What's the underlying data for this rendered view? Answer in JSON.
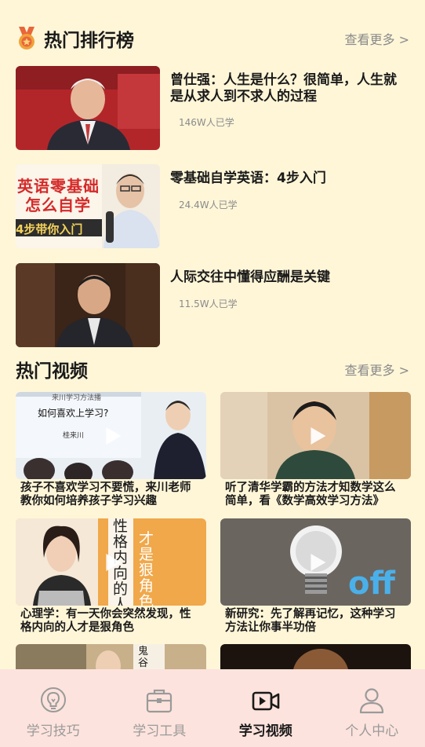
{
  "hot_ranking": {
    "title": "热门排行榜",
    "more": "查看更多 >",
    "items": [
      {
        "title": "曾仕强：人生是什么？很简单，人生就是从求人到不求人的过程",
        "count": "146W人已学"
      },
      {
        "title": "零基础自学英语：4步入门",
        "count": "24.4W人已学",
        "thumb_text_1": "英语零基础",
        "thumb_text_2": "怎么自学",
        "thumb_text_3": "4步带你入门"
      },
      {
        "title": "人际交往中懂得应酬是关键",
        "count": "11.5W人已学"
      }
    ]
  },
  "hot_videos": {
    "title": "热门视频",
    "more": "查看更多 >",
    "items": [
      {
        "title": "孩子不喜欢学习不要慌，来川老师教你如何培养孩子学习兴趣",
        "thumb_text_1": "来川学习方法播",
        "thumb_text_2": "如何喜欢上学习?",
        "thumb_text_3": "桂来川"
      },
      {
        "title": "听了清华学霸的方法才知数学这么简单，看《数学高效学习方法》"
      },
      {
        "title": "心理学：有一天你会突然发现，性格内向的人才是狠角色",
        "thumb_text_1": "性格内向的人",
        "thumb_text_2": "才是狠角色"
      },
      {
        "title": "新研究：先了解再记忆，这种学习方法让你事半功倍",
        "thumb_text_1": "off"
      },
      {
        "title": "",
        "thumb_text_1": "鬼谷"
      },
      {
        "title": ""
      }
    ]
  },
  "tabbar": {
    "tabs": [
      {
        "label": "学习技巧",
        "icon": "lightbulb-icon"
      },
      {
        "label": "学习工具",
        "icon": "toolbox-icon"
      },
      {
        "label": "学习视频",
        "icon": "video-icon"
      },
      {
        "label": "个人中心",
        "icon": "person-icon"
      }
    ],
    "active_index": 2
  },
  "colors": {
    "background": "#fff6d8",
    "tabbar_background": "#fde3dd",
    "medal": "#e8663a"
  }
}
